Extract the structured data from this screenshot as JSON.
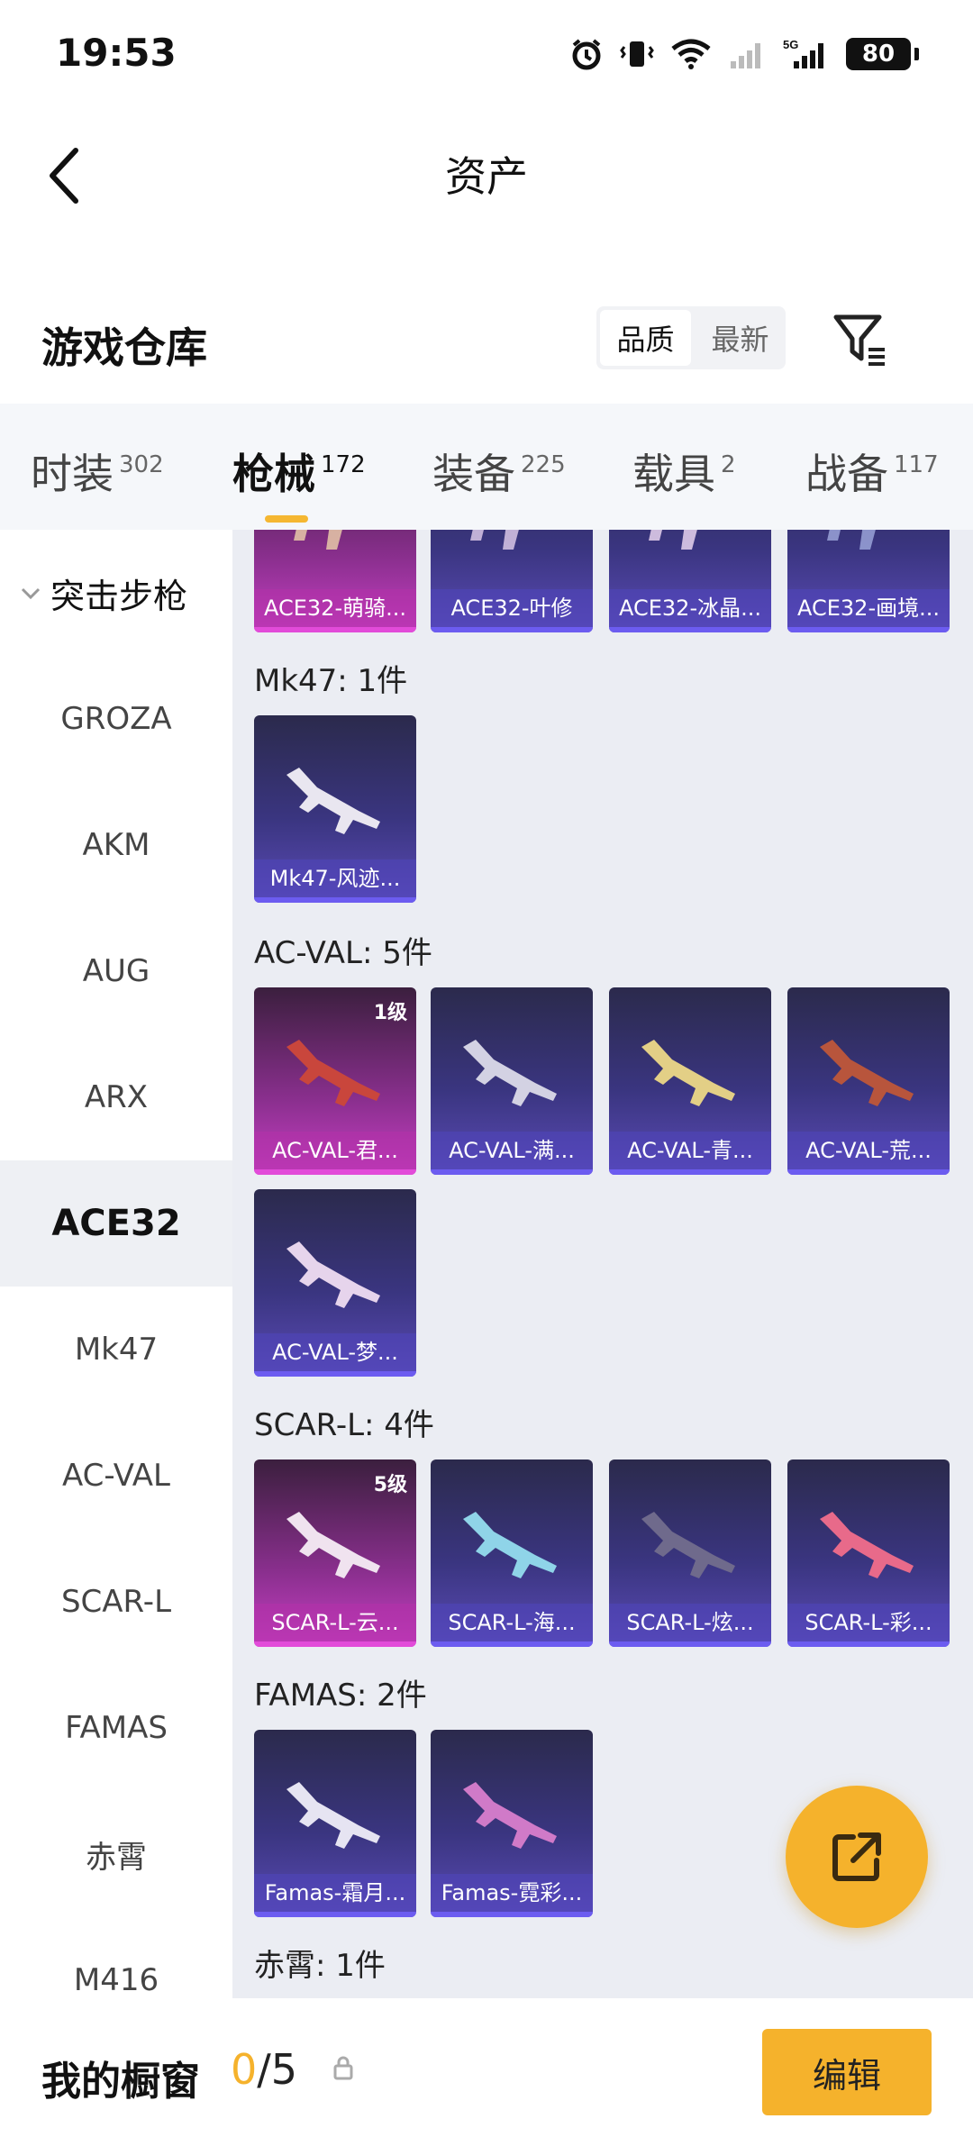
{
  "status_bar": {
    "time": "19:53",
    "battery": "80",
    "network": "5G"
  },
  "header": {
    "title": "资产"
  },
  "section": {
    "title": "游戏仓库",
    "sort_options": [
      "品质",
      "最新"
    ],
    "sort_active": 0
  },
  "tabs": [
    {
      "label": "时装",
      "count": "302"
    },
    {
      "label": "枪械",
      "count": "172",
      "active": true
    },
    {
      "label": "装备",
      "count": "225"
    },
    {
      "label": "载具",
      "count": "2"
    },
    {
      "label": "战备",
      "count": "117"
    }
  ],
  "sidebar": {
    "category": "突击步枪",
    "items": [
      "GROZA",
      "AKM",
      "AUG",
      "ARX",
      "ACE32",
      "Mk47",
      "AC-VAL",
      "SCAR-L",
      "FAMAS",
      "赤霄",
      "M416"
    ],
    "active": "ACE32"
  },
  "groups": [
    {
      "title": "",
      "items": [
        {
          "name": "ACE32-萌骑...",
          "rarity": "pink"
        },
        {
          "name": "ACE32-叶修",
          "rarity": "purple"
        },
        {
          "name": "ACE32-冰晶...",
          "rarity": "purple"
        },
        {
          "name": "ACE32-画境...",
          "rarity": "purple"
        }
      ]
    },
    {
      "title": "Mk47: 1件",
      "items": [
        {
          "name": "Mk47-风迹...",
          "rarity": "purple"
        }
      ]
    },
    {
      "title": "AC-VAL: 5件",
      "items": [
        {
          "name": "AC-VAL-君...",
          "rarity": "pink",
          "level": "1级"
        },
        {
          "name": "AC-VAL-满...",
          "rarity": "purple"
        },
        {
          "name": "AC-VAL-青...",
          "rarity": "purple"
        },
        {
          "name": "AC-VAL-荒...",
          "rarity": "purple"
        },
        {
          "name": "AC-VAL-梦...",
          "rarity": "purple"
        }
      ]
    },
    {
      "title": "SCAR-L: 4件",
      "items": [
        {
          "name": "SCAR-L-云...",
          "rarity": "pink",
          "level": "5级"
        },
        {
          "name": "SCAR-L-海...",
          "rarity": "purple"
        },
        {
          "name": "SCAR-L-炫...",
          "rarity": "purple"
        },
        {
          "name": "SCAR-L-彩...",
          "rarity": "purple"
        }
      ]
    },
    {
      "title": "FAMAS: 2件",
      "items": [
        {
          "name": "Famas-霜月...",
          "rarity": "purple"
        },
        {
          "name": "Famas-霓彩...",
          "rarity": "purple"
        }
      ]
    },
    {
      "title": "赤霄: 1件",
      "items": []
    }
  ],
  "bottom_bar": {
    "label": "我的橱窗",
    "current": "0",
    "separator": "/",
    "max": "5",
    "edit_label": "编辑"
  },
  "colors": {
    "accent": "#f5b22c",
    "card_purple": "#3a3580",
    "card_pink": "#c63fc3"
  }
}
